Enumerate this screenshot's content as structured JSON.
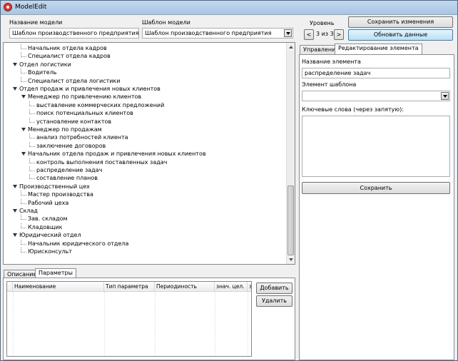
{
  "window": {
    "title": "ModelEdit"
  },
  "header": {
    "model_name_label": "Название модели",
    "model_name_value": "Шаблон производственного предприятия",
    "template_label": "Шаблон модели",
    "template_value": "Шаблон производственного предприятия",
    "level_label": "Уровень",
    "level_value": "3 из 3",
    "prev_label": "<",
    "next_label": ">",
    "save_changes_label": "Сохранить изменения",
    "refresh_label": "Обновить данные"
  },
  "tree": {
    "items": [
      {
        "label": "Начальник отдела кадров",
        "level": 1,
        "expandable": false
      },
      {
        "label": "Специалист отдела кадров",
        "level": 1,
        "expandable": false
      },
      {
        "label": "Отдел логистики",
        "level": 0,
        "expandable": true
      },
      {
        "label": "Водитель",
        "level": 1,
        "expandable": false
      },
      {
        "label": "Специалист отдела логистики",
        "level": 1,
        "expandable": false
      },
      {
        "label": "Отдел продаж и привлечения новых клиентов",
        "level": 0,
        "expandable": true
      },
      {
        "label": "Менеджер по привлечению клиентов",
        "level": 1,
        "expandable": true
      },
      {
        "label": "выставление коммерческих предложений",
        "level": 2,
        "expandable": false
      },
      {
        "label": "поиск потенциальных клиентов",
        "level": 2,
        "expandable": false
      },
      {
        "label": "установление контактов",
        "level": 2,
        "expandable": false
      },
      {
        "label": "Менеджер по продажам",
        "level": 1,
        "expandable": true
      },
      {
        "label": "анализ потребностей клиента",
        "level": 2,
        "expandable": false
      },
      {
        "label": "заключение договоров",
        "level": 2,
        "expandable": false
      },
      {
        "label": "Начальник отдела продаж и привлечения новых клиентов",
        "level": 1,
        "expandable": true
      },
      {
        "label": "контроль выполнения поставленных задач",
        "level": 2,
        "expandable": false
      },
      {
        "label": "распределение задач",
        "level": 2,
        "expandable": false
      },
      {
        "label": "составление планов",
        "level": 2,
        "expandable": false
      },
      {
        "label": "Производственный цех",
        "level": 0,
        "expandable": true
      },
      {
        "label": "Мастер производства",
        "level": 1,
        "expandable": false
      },
      {
        "label": "Рабочий цеха",
        "level": 1,
        "expandable": false
      },
      {
        "label": "Склад",
        "level": 0,
        "expandable": true
      },
      {
        "label": "Зав. складом",
        "level": 1,
        "expandable": false
      },
      {
        "label": "Кладовщик",
        "level": 1,
        "expandable": false
      },
      {
        "label": "Юридический отдел",
        "level": 0,
        "expandable": true
      },
      {
        "label": "Начальник юридического отдела",
        "level": 1,
        "expandable": false
      },
      {
        "label": "Юрисконсульт",
        "level": 1,
        "expandable": false
      }
    ]
  },
  "bottom_tabs": {
    "description": "Описание",
    "parameters": "Параметры"
  },
  "params_grid": {
    "columns": [
      "Наименование",
      "Тип параметра",
      "Периодиность",
      "знач. цел.",
      "зн"
    ]
  },
  "params_buttons": {
    "add": "Добавить",
    "delete": "Удалить"
  },
  "right_tabs": {
    "management": "Управление",
    "edit_element": "Редактирование элемента"
  },
  "edit_element": {
    "name_label": "Название элемента",
    "name_value": "распределение задач",
    "template_element_label": "Элемент шаблона",
    "template_element_value": "",
    "keywords_label": "Ключевые слова (через запятую):",
    "keywords_value": "",
    "save_label": "Сохранить"
  }
}
